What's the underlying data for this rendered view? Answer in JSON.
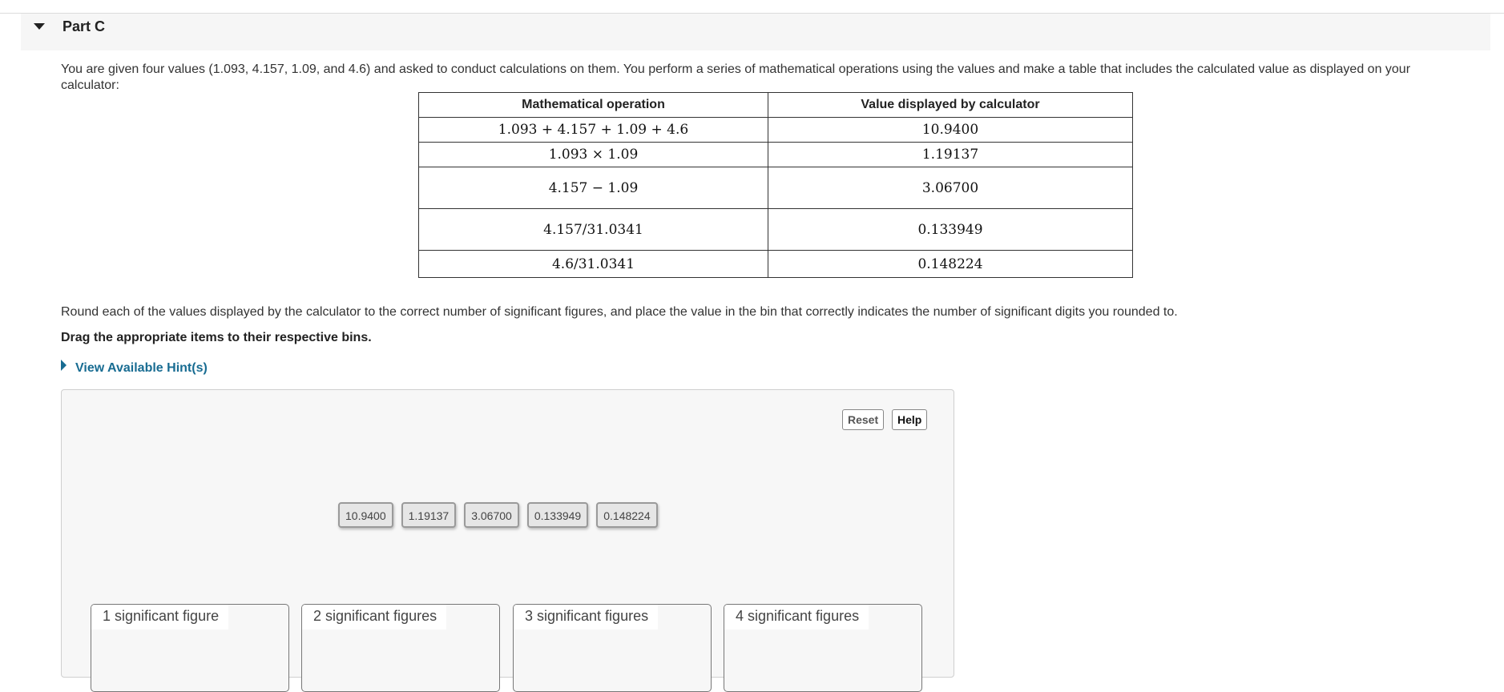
{
  "part": {
    "title": "Part C"
  },
  "intro_text": "You are given four values (1.093, 4.157, 1.09, and 4.6) and asked to conduct calculations on them. You perform a series of mathematical operations using the values and make a table that includes the calculated value as displayed on your calculator:",
  "table": {
    "headers": [
      "Mathematical operation",
      "Value displayed by calculator"
    ],
    "rows": [
      {
        "operation": "1.093 + 4.157 + 1.09 + 4.6",
        "value": "10.9400"
      },
      {
        "operation": "1.093 × 1.09",
        "value": "1.19137"
      },
      {
        "operation": "4.157 −  1.09",
        "value": "3.06700"
      },
      {
        "operation": "4.157/31.0341",
        "value": "0.133949"
      },
      {
        "operation": "4.6/31.0341",
        "value": "0.148224"
      }
    ]
  },
  "instruction": "Round each of the values displayed by the calculator to the correct number of significant figures, and place the value in the bin that correctly indicates the number of significant digits you rounded to.",
  "drag_instruction": "Drag the appropriate items to their respective bins.",
  "hint_link": "View Available Hint(s)",
  "buttons": {
    "reset": "Reset",
    "help": "Help"
  },
  "tokens": [
    "10.9400",
    "1.19137",
    "3.06700",
    "0.133949",
    "0.148224"
  ],
  "bins": [
    "1 significant figure",
    "2 significant figures",
    "3 significant figures",
    "4 significant figures"
  ]
}
